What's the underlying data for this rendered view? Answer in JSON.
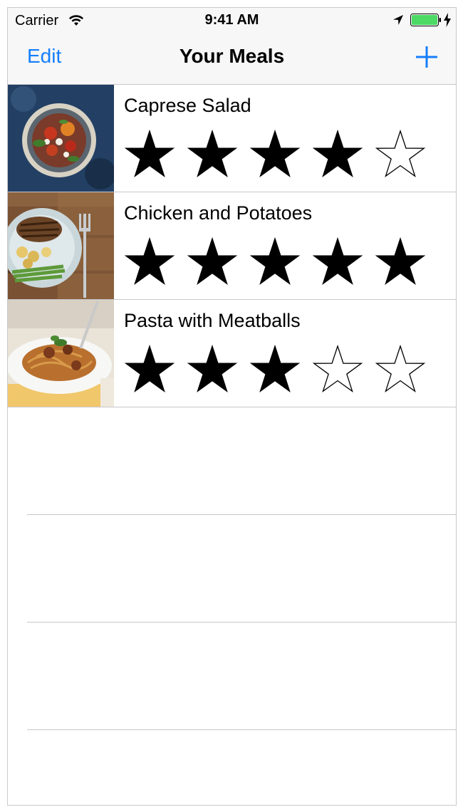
{
  "status_bar": {
    "carrier": "Carrier",
    "time": "9:41 AM",
    "battery_color": "#4cd964"
  },
  "nav": {
    "edit_label": "Edit",
    "title": "Your Meals",
    "add_icon": "plus-icon",
    "tint_color": "#157efb"
  },
  "meals": [
    {
      "name": "Caprese Salad",
      "rating": 4,
      "max_rating": 5,
      "photo": "caprese-salad-photo"
    },
    {
      "name": "Chicken and Potatoes",
      "rating": 5,
      "max_rating": 5,
      "photo": "chicken-potatoes-photo"
    },
    {
      "name": "Pasta with Meatballs",
      "rating": 3,
      "max_rating": 5,
      "photo": "pasta-meatballs-photo"
    }
  ]
}
